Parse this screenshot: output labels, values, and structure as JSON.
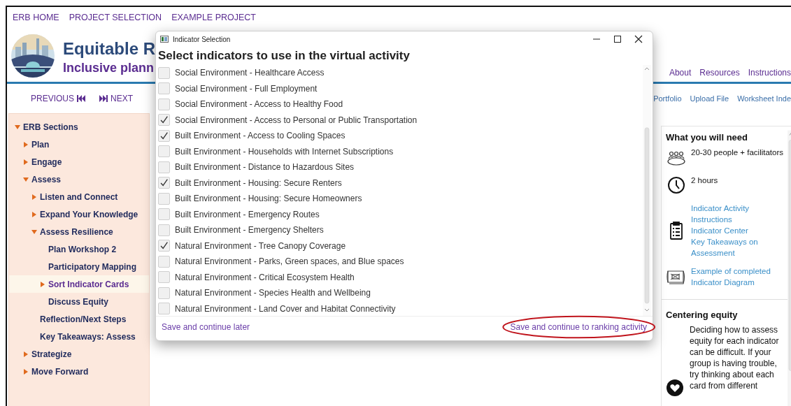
{
  "top_nav": [
    "ERB HOME",
    "PROJECT SELECTION",
    "EXAMPLE PROJECT"
  ],
  "header": {
    "title": "Equitable R",
    "subtitle": "Inclusive plann"
  },
  "header_links": [
    "About",
    "Resources",
    "Instructions"
  ],
  "page_nav": {
    "previous": "PREVIOUS",
    "next": "NEXT"
  },
  "tool_links": [
    "Portfolio",
    "Upload File",
    "Worksheet Inde"
  ],
  "sidebar": {
    "items": [
      {
        "label": "ERB Sections",
        "kind": "branch",
        "expanded": true,
        "selected": false,
        "children": [
          {
            "label": "Plan",
            "kind": "branch",
            "expanded": false,
            "selected": false
          },
          {
            "label": "Engage",
            "kind": "branch",
            "expanded": false,
            "selected": false
          },
          {
            "label": "Assess",
            "kind": "branch",
            "expanded": true,
            "selected": false,
            "children": [
              {
                "label": "Listen and Connect",
                "kind": "branch",
                "expanded": false,
                "selected": false
              },
              {
                "label": "Expand Your Knowledge",
                "kind": "branch",
                "expanded": false,
                "selected": false
              },
              {
                "label": "Assess Resilience",
                "kind": "branch",
                "expanded": true,
                "selected": false,
                "children": [
                  {
                    "label": "Plan Workshop 2",
                    "kind": "leaf",
                    "selected": false
                  },
                  {
                    "label": "Participatory Mapping",
                    "kind": "leaf",
                    "selected": false
                  },
                  {
                    "label": "Sort Indicator Cards",
                    "kind": "branch",
                    "expanded": false,
                    "selected": true
                  },
                  {
                    "label": "Discuss Equity",
                    "kind": "leaf",
                    "selected": false
                  }
                ]
              },
              {
                "label": "Reflection/Next Steps",
                "kind": "leaf",
                "selected": false
              },
              {
                "label": "Key Takeaways: Assess",
                "kind": "leaf",
                "selected": false
              }
            ]
          },
          {
            "label": "Strategize",
            "kind": "branch",
            "expanded": false,
            "selected": false
          },
          {
            "label": "Move Forward",
            "kind": "branch",
            "expanded": false,
            "selected": false
          }
        ]
      }
    ]
  },
  "right_panel": {
    "heading": "What you will need",
    "items": [
      {
        "kind": "people",
        "texts": [
          "20-30 people + facilitators"
        ]
      },
      {
        "kind": "clock",
        "texts": [
          "2 hours"
        ]
      },
      {
        "kind": "clipboard",
        "texts": [
          "Indicator Activity Instructions",
          "Indicator Center",
          "Key Takeaways on Assessment"
        ]
      },
      {
        "kind": "diagram",
        "texts": [
          "Example of completed Indicator Diagram"
        ]
      }
    ],
    "section2_heading": "Centering equity",
    "section2_text": "Deciding how to assess equity for each indicator can be difficult. If your group is having trouble, try thinking about each card from different"
  },
  "dialog": {
    "title": "Indicator Selection",
    "heading": "Select indicators to use in the virtual activity",
    "options": [
      {
        "label": "Social Environment - Healthcare Access",
        "checked": false
      },
      {
        "label": "Social Environment - Full Employment",
        "checked": false
      },
      {
        "label": "Social Environment - Access to Healthy Food",
        "checked": false
      },
      {
        "label": "Social Environment - Access to Personal or Public Transportation",
        "checked": true
      },
      {
        "label": "Built Environment - Access to Cooling Spaces",
        "checked": true
      },
      {
        "label": "Built Environment - Households with Internet Subscriptions",
        "checked": false
      },
      {
        "label": "Built Environment - Distance to Hazardous Sites",
        "checked": false
      },
      {
        "label": "Built Environment - Housing: Secure Renters",
        "checked": true
      },
      {
        "label": "Built Environment - Housing: Secure Homeowners",
        "checked": false
      },
      {
        "label": "Built Environment - Emergency Routes",
        "checked": false
      },
      {
        "label": "Built Environment - Emergency Shelters",
        "checked": false
      },
      {
        "label": "Natural Environment - Tree Canopy Coverage",
        "checked": true
      },
      {
        "label": "Natural Environment - Parks, Green spaces, and Blue spaces",
        "checked": false
      },
      {
        "label": "Natural Environment - Critical Ecosystem Health",
        "checked": false
      },
      {
        "label": "Natural Environment - Species Health and Wellbeing",
        "checked": false
      },
      {
        "label": "Natural Environment - Land Cover and Habitat Connectivity",
        "checked": false
      }
    ],
    "actions": [
      {
        "label": "Save and continue later",
        "highlighted": false
      },
      {
        "label": "Save and continue to ranking activity",
        "highlighted": true
      }
    ]
  }
}
